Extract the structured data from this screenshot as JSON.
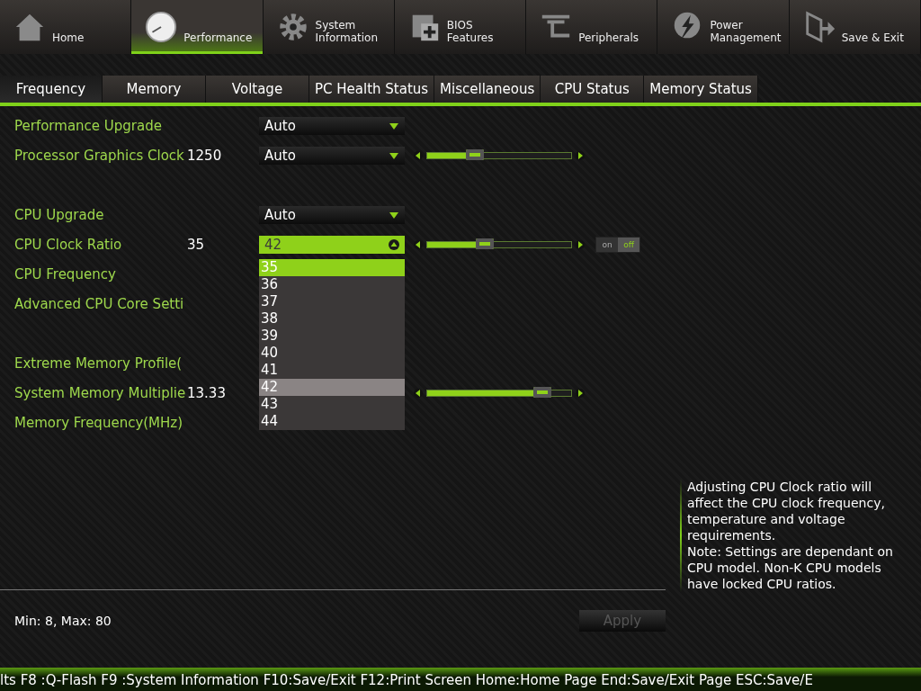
{
  "top_nav": [
    {
      "label": "Home",
      "selected": false
    },
    {
      "label": "Performance",
      "selected": true
    },
    {
      "label": "System\nInformation",
      "selected": false
    },
    {
      "label": "BIOS\nFeatures",
      "selected": false
    },
    {
      "label": "Peripherals",
      "selected": false
    },
    {
      "label": "Power\nManagement",
      "selected": false
    },
    {
      "label": "Save & Exit",
      "selected": false
    }
  ],
  "sub_tabs": [
    {
      "label": "Frequency",
      "selected": true
    },
    {
      "label": "Memory",
      "selected": false
    },
    {
      "label": "Voltage",
      "selected": false
    },
    {
      "label": "PC Health Status",
      "selected": false
    },
    {
      "label": "Miscellaneous",
      "selected": false
    },
    {
      "label": "CPU Status",
      "selected": false
    },
    {
      "label": "Memory Status",
      "selected": false
    }
  ],
  "setting_groups": [
    [
      {
        "label": "Performance Upgrade",
        "dropdown": "Auto"
      },
      {
        "label": "Processor Graphics Clock",
        "value": "1250",
        "dropdown": "Auto",
        "slider": {
          "level": 0.33
        }
      }
    ],
    [
      {
        "label": "CPU Upgrade",
        "dropdown": "Auto"
      },
      {
        "label": "CPU Clock Ratio",
        "value": "35",
        "dropdown": "42",
        "open": true,
        "slider": {
          "level": 0.4
        },
        "toggle": {
          "on_label": "on",
          "off_label": "off",
          "on": false
        }
      },
      {
        "label": "CPU Frequency"
      },
      {
        "label": "Advanced CPU Core Setti"
      }
    ],
    [
      {
        "label": "Extreme Memory Profile("
      },
      {
        "label": "System Memory Multiplie",
        "value": "13.33",
        "slider": {
          "level": 0.8
        }
      },
      {
        "label": "Memory Frequency(MHz)"
      }
    ]
  ],
  "dropdown_options": [
    {
      "label": "35",
      "selected": true,
      "highlighted": false
    },
    {
      "label": "36",
      "selected": false,
      "highlighted": false
    },
    {
      "label": "37",
      "selected": false,
      "highlighted": false
    },
    {
      "label": "38",
      "selected": false,
      "highlighted": false
    },
    {
      "label": "39",
      "selected": false,
      "highlighted": false
    },
    {
      "label": "40",
      "selected": false,
      "highlighted": false
    },
    {
      "label": "41",
      "selected": false,
      "highlighted": false
    },
    {
      "label": "42",
      "selected": false,
      "highlighted": true
    },
    {
      "label": "43",
      "selected": false,
      "highlighted": false
    },
    {
      "label": "44",
      "selected": false,
      "highlighted": false
    }
  ],
  "help_text": "Adjusting CPU Clock ratio will affect the CPU clock frequency, temperature and voltage requirements.\nNote: Settings are dependant  on  CPU model. Non-K CPU models have locked CPU ratios.",
  "range_text": "Min: 8, Max: 80",
  "apply_button": {
    "label": "Apply",
    "disabled": true
  },
  "status_bar": "lts F8 :Q-Flash F9 :System Information F10:Save/Exit F12:Print Screen Home:Home Page End:Save/Exit Page ESC:Save/E"
}
